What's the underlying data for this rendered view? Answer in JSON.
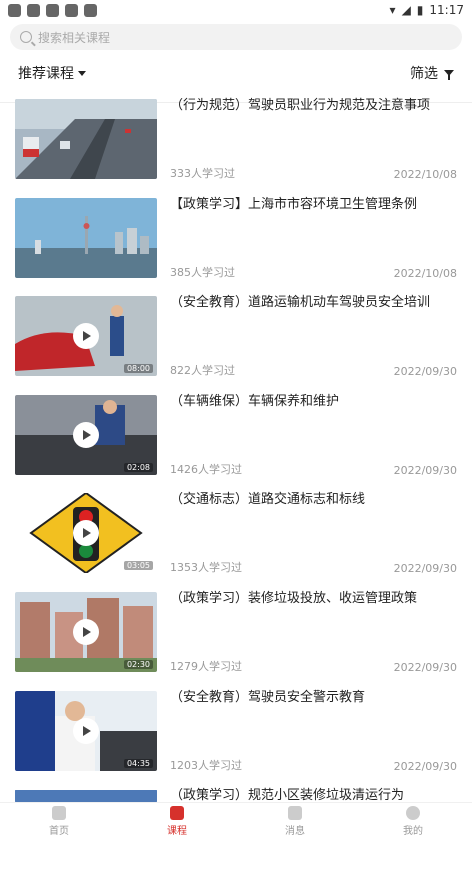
{
  "status_bar": {
    "time": "11:17"
  },
  "search": {
    "placeholder": "搜索相关课程"
  },
  "filters": {
    "sort_label": "推荐课程",
    "filter_label": "筛选"
  },
  "courses": [
    {
      "title": "（行为规范）驾驶员职业行为规范及注意事项",
      "views": "333人学习过",
      "date": "2022/10/08"
    },
    {
      "title": "【政策学习】上海市市容环境卫生管理条例",
      "views": "385人学习过",
      "date": "2022/10/08"
    },
    {
      "title": "（安全教育）道路运输机动车驾驶员安全培训",
      "views": "822人学习过",
      "date": "2022/09/30",
      "duration": "08:00"
    },
    {
      "title": "（车辆维保）车辆保养和维护",
      "views": "1426人学习过",
      "date": "2022/09/30",
      "duration": "02:08"
    },
    {
      "title": "（交通标志）道路交通标志和标线",
      "views": "1353人学习过",
      "date": "2022/09/30",
      "duration": "03:05"
    },
    {
      "title": "（政策学习）装修垃圾投放、收运管理政策",
      "views": "1279人学习过",
      "date": "2022/09/30",
      "duration": "02:30"
    },
    {
      "title": "（安全教育）驾驶员安全警示教育",
      "views": "1203人学习过",
      "date": "2022/09/30",
      "duration": "04:35"
    },
    {
      "title": "（政策学习）规范小区装修垃圾清运行为"
    }
  ],
  "tabs": [
    {
      "label": "首页",
      "icon": "home-icon"
    },
    {
      "label": "课程",
      "icon": "course-icon"
    },
    {
      "label": "消息",
      "icon": "message-icon"
    },
    {
      "label": "我的",
      "icon": "profile-icon"
    }
  ],
  "colors": {
    "accent": "#d6312c"
  }
}
